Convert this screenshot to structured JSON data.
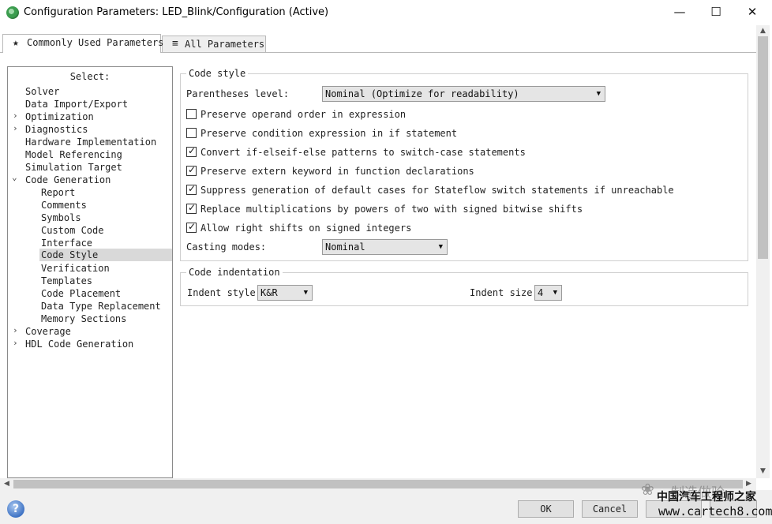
{
  "window": {
    "title": "Configuration Parameters: LED_Blink/Configuration (Active)",
    "minimize_glyph": "—",
    "maximize_glyph": "☐",
    "close_glyph": "✕",
    "app_icon": "simulink-config-icon"
  },
  "tabs": [
    {
      "label": "Commonly Used Parameters",
      "icon": "★",
      "active": true
    },
    {
      "label": "All Parameters",
      "icon": "≡",
      "active": false
    }
  ],
  "tree": {
    "header": "Select:",
    "items": [
      {
        "label": "Solver",
        "expander": ""
      },
      {
        "label": "Data Import/Export",
        "expander": ""
      },
      {
        "label": "Optimization",
        "expander": "›"
      },
      {
        "label": "Diagnostics",
        "expander": "›"
      },
      {
        "label": "Hardware Implementation",
        "expander": ""
      },
      {
        "label": "Model Referencing",
        "expander": ""
      },
      {
        "label": "Simulation Target",
        "expander": ""
      },
      {
        "label": "Code Generation",
        "expander": "⌄"
      },
      {
        "label": "Report",
        "expander": ""
      },
      {
        "label": "Comments",
        "expander": ""
      },
      {
        "label": "Symbols",
        "expander": ""
      },
      {
        "label": "Custom Code",
        "expander": ""
      },
      {
        "label": "Interface",
        "expander": ""
      },
      {
        "label": "Code Style",
        "expander": "",
        "selected": true
      },
      {
        "label": "Verification",
        "expander": ""
      },
      {
        "label": "Templates",
        "expander": ""
      },
      {
        "label": "Code Placement",
        "expander": ""
      },
      {
        "label": "Data Type Replacement",
        "expander": ""
      },
      {
        "label": "Memory Sections",
        "expander": ""
      },
      {
        "label": "Coverage",
        "expander": "›"
      },
      {
        "label": "HDL Code Generation",
        "expander": "›"
      }
    ]
  },
  "code_style": {
    "legend": "Code style",
    "parentheses_label": "Parentheses level:",
    "parentheses_value": "Nominal (Optimize for readability)",
    "checkboxes": [
      {
        "label": "Preserve operand order in expression",
        "checked": false
      },
      {
        "label": "Preserve condition expression in if statement",
        "checked": false
      },
      {
        "label": "Convert if-elseif-else patterns to switch-case statements",
        "checked": true
      },
      {
        "label": "Preserve extern keyword in function declarations",
        "checked": true
      },
      {
        "label": "Suppress generation of default cases for Stateflow switch statements if unreachable",
        "checked": true
      },
      {
        "label": "Replace multiplications by powers of two with signed bitwise shifts",
        "checked": true
      },
      {
        "label": "Allow right shifts on signed integers",
        "checked": true
      }
    ],
    "casting_label": "Casting modes:",
    "casting_value": "Nominal"
  },
  "code_indentation": {
    "legend": "Code indentation",
    "indent_style_label": "Indent style:",
    "indent_style_value": "K&R",
    "indent_size_label": "Indent size:",
    "indent_size_value": "4"
  },
  "footer": {
    "help_glyph": "?",
    "ok_label": "OK",
    "cancel_label": "Cancel"
  },
  "watermark": {
    "line1": "制造做验",
    "line2": "中国汽车工程师之家",
    "line3": "www.cartech8.com"
  }
}
